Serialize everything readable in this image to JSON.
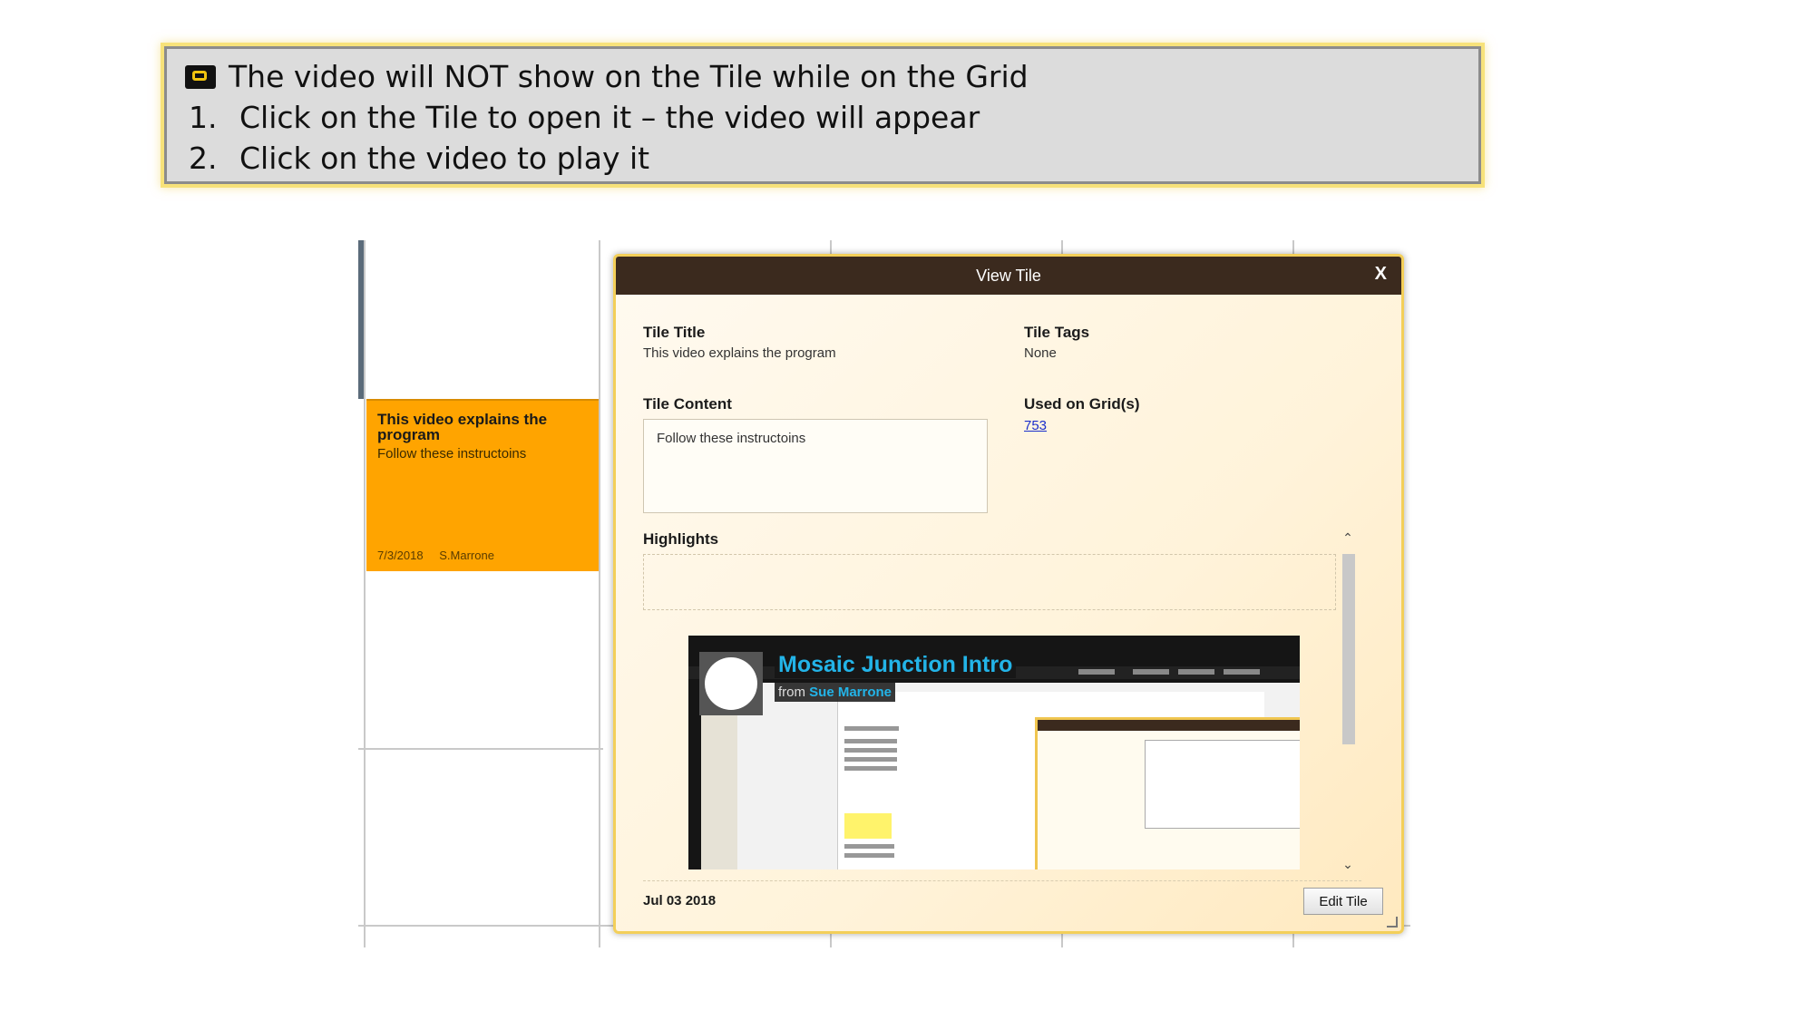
{
  "callout": {
    "headline": "The video will NOT show on the Tile while on the Grid",
    "steps": [
      {
        "num": "1.",
        "text": "Click on the Tile to open it – the video will appear"
      },
      {
        "num": "2.",
        "text": "Click on the video to play it"
      }
    ],
    "icon": "video-tile-icon"
  },
  "grid_tile": {
    "title": "This video explains the program",
    "body": "Follow these instructoins",
    "date": "7/3/2018",
    "author": "S.Marrone",
    "color": "#ffa400"
  },
  "modal": {
    "title": "View Tile",
    "close_label": "X",
    "tile_title_label": "Tile Title",
    "tile_title_value": "This video explains the program",
    "tile_tags_label": "Tile Tags",
    "tile_tags_value": "None",
    "tile_content_label": "Tile Content",
    "tile_content_value": "Follow these instructoins",
    "used_on_grids_label": "Used on Grid(s)",
    "used_on_grids_value": "753",
    "highlights_label": "Highlights",
    "footer_date": "Jul 03 2018",
    "edit_button": "Edit Tile",
    "header_color": "#3b2a1e",
    "border_color": "#f3cf59"
  },
  "video": {
    "title": "Mosaic Junction Intro",
    "from_label": "from",
    "author": "Sue Marrone",
    "title_color": "#23b4e8"
  }
}
